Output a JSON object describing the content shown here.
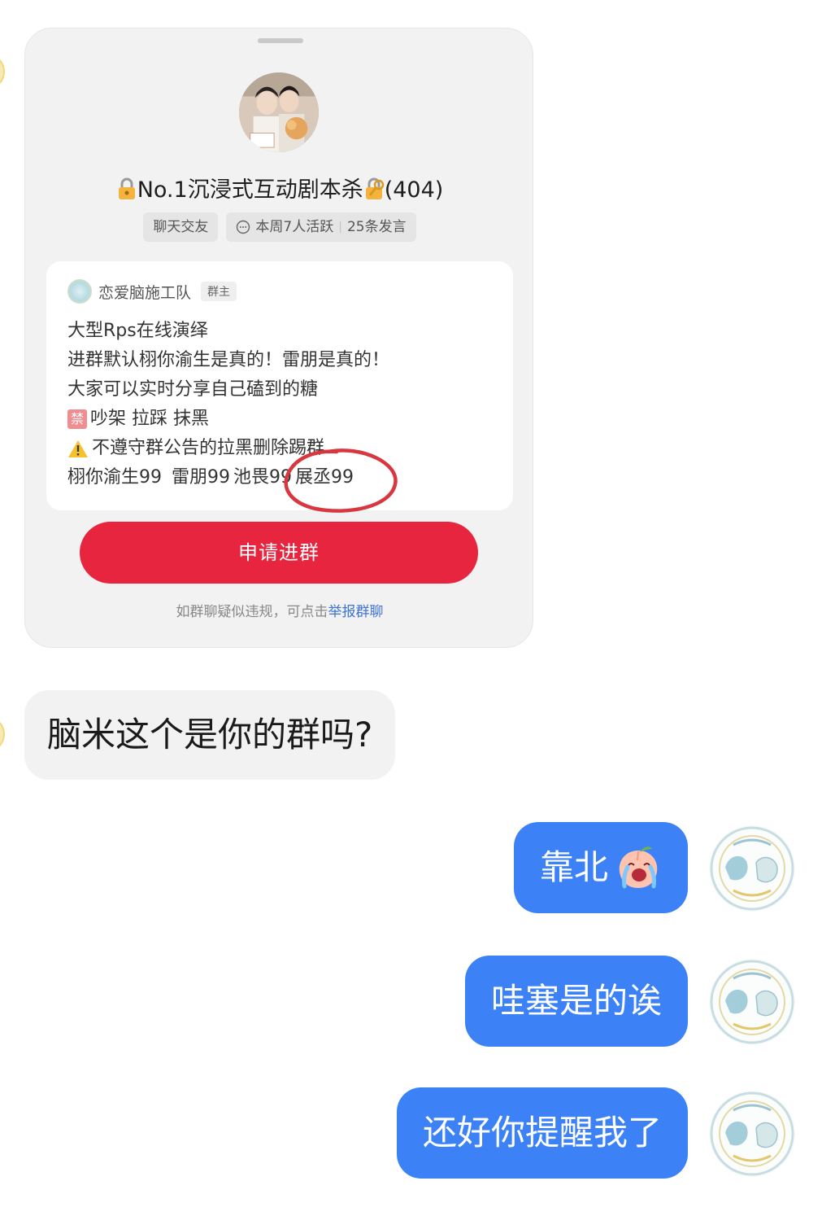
{
  "group_card": {
    "title": "No.1沉浸式互动剧本杀",
    "member_count": "(404)",
    "tags": {
      "category": "聊天交友",
      "activity": "本周7人活跃",
      "messages": "25条发言"
    },
    "notice": {
      "owner_name": "恋爱脑施工队",
      "owner_badge": "群主",
      "lines": [
        "大型Rps在线演绎",
        "进群默认栩你渝生是真的！雷朋是真的！",
        "大家可以实时分享自己磕到的糖"
      ],
      "ban_label": "禁",
      "ban_text": "吵架 拉踩 抹黑",
      "warn_text": "不遵守群公告的拉黑删除踢群",
      "cp_items": [
        "栩你渝生99",
        "雷朋99",
        "池畏99",
        "展丞99"
      ]
    },
    "apply_button": "申请进群",
    "report_prefix": "如群聊疑似违规，可点击",
    "report_link": "举报群聊"
  },
  "messages": {
    "incoming": "脑米这个是你的群吗?",
    "outgoing": [
      "靠北",
      "哇塞是的诶",
      "还好你提醒我了"
    ]
  },
  "icons": {
    "title_left": "lock-icon",
    "title_right": "lock-key-icon",
    "activity": "chat-bubble-icon",
    "warning": "warning-icon",
    "emoji": "crying-peach-emoji"
  },
  "colors": {
    "apply_button": "#e8253f",
    "outgoing_bubble": "#3c82f6",
    "incoming_bubble": "#f2f2f2",
    "report_link": "#3e74d6",
    "annotation_circle": "#d9373f"
  }
}
